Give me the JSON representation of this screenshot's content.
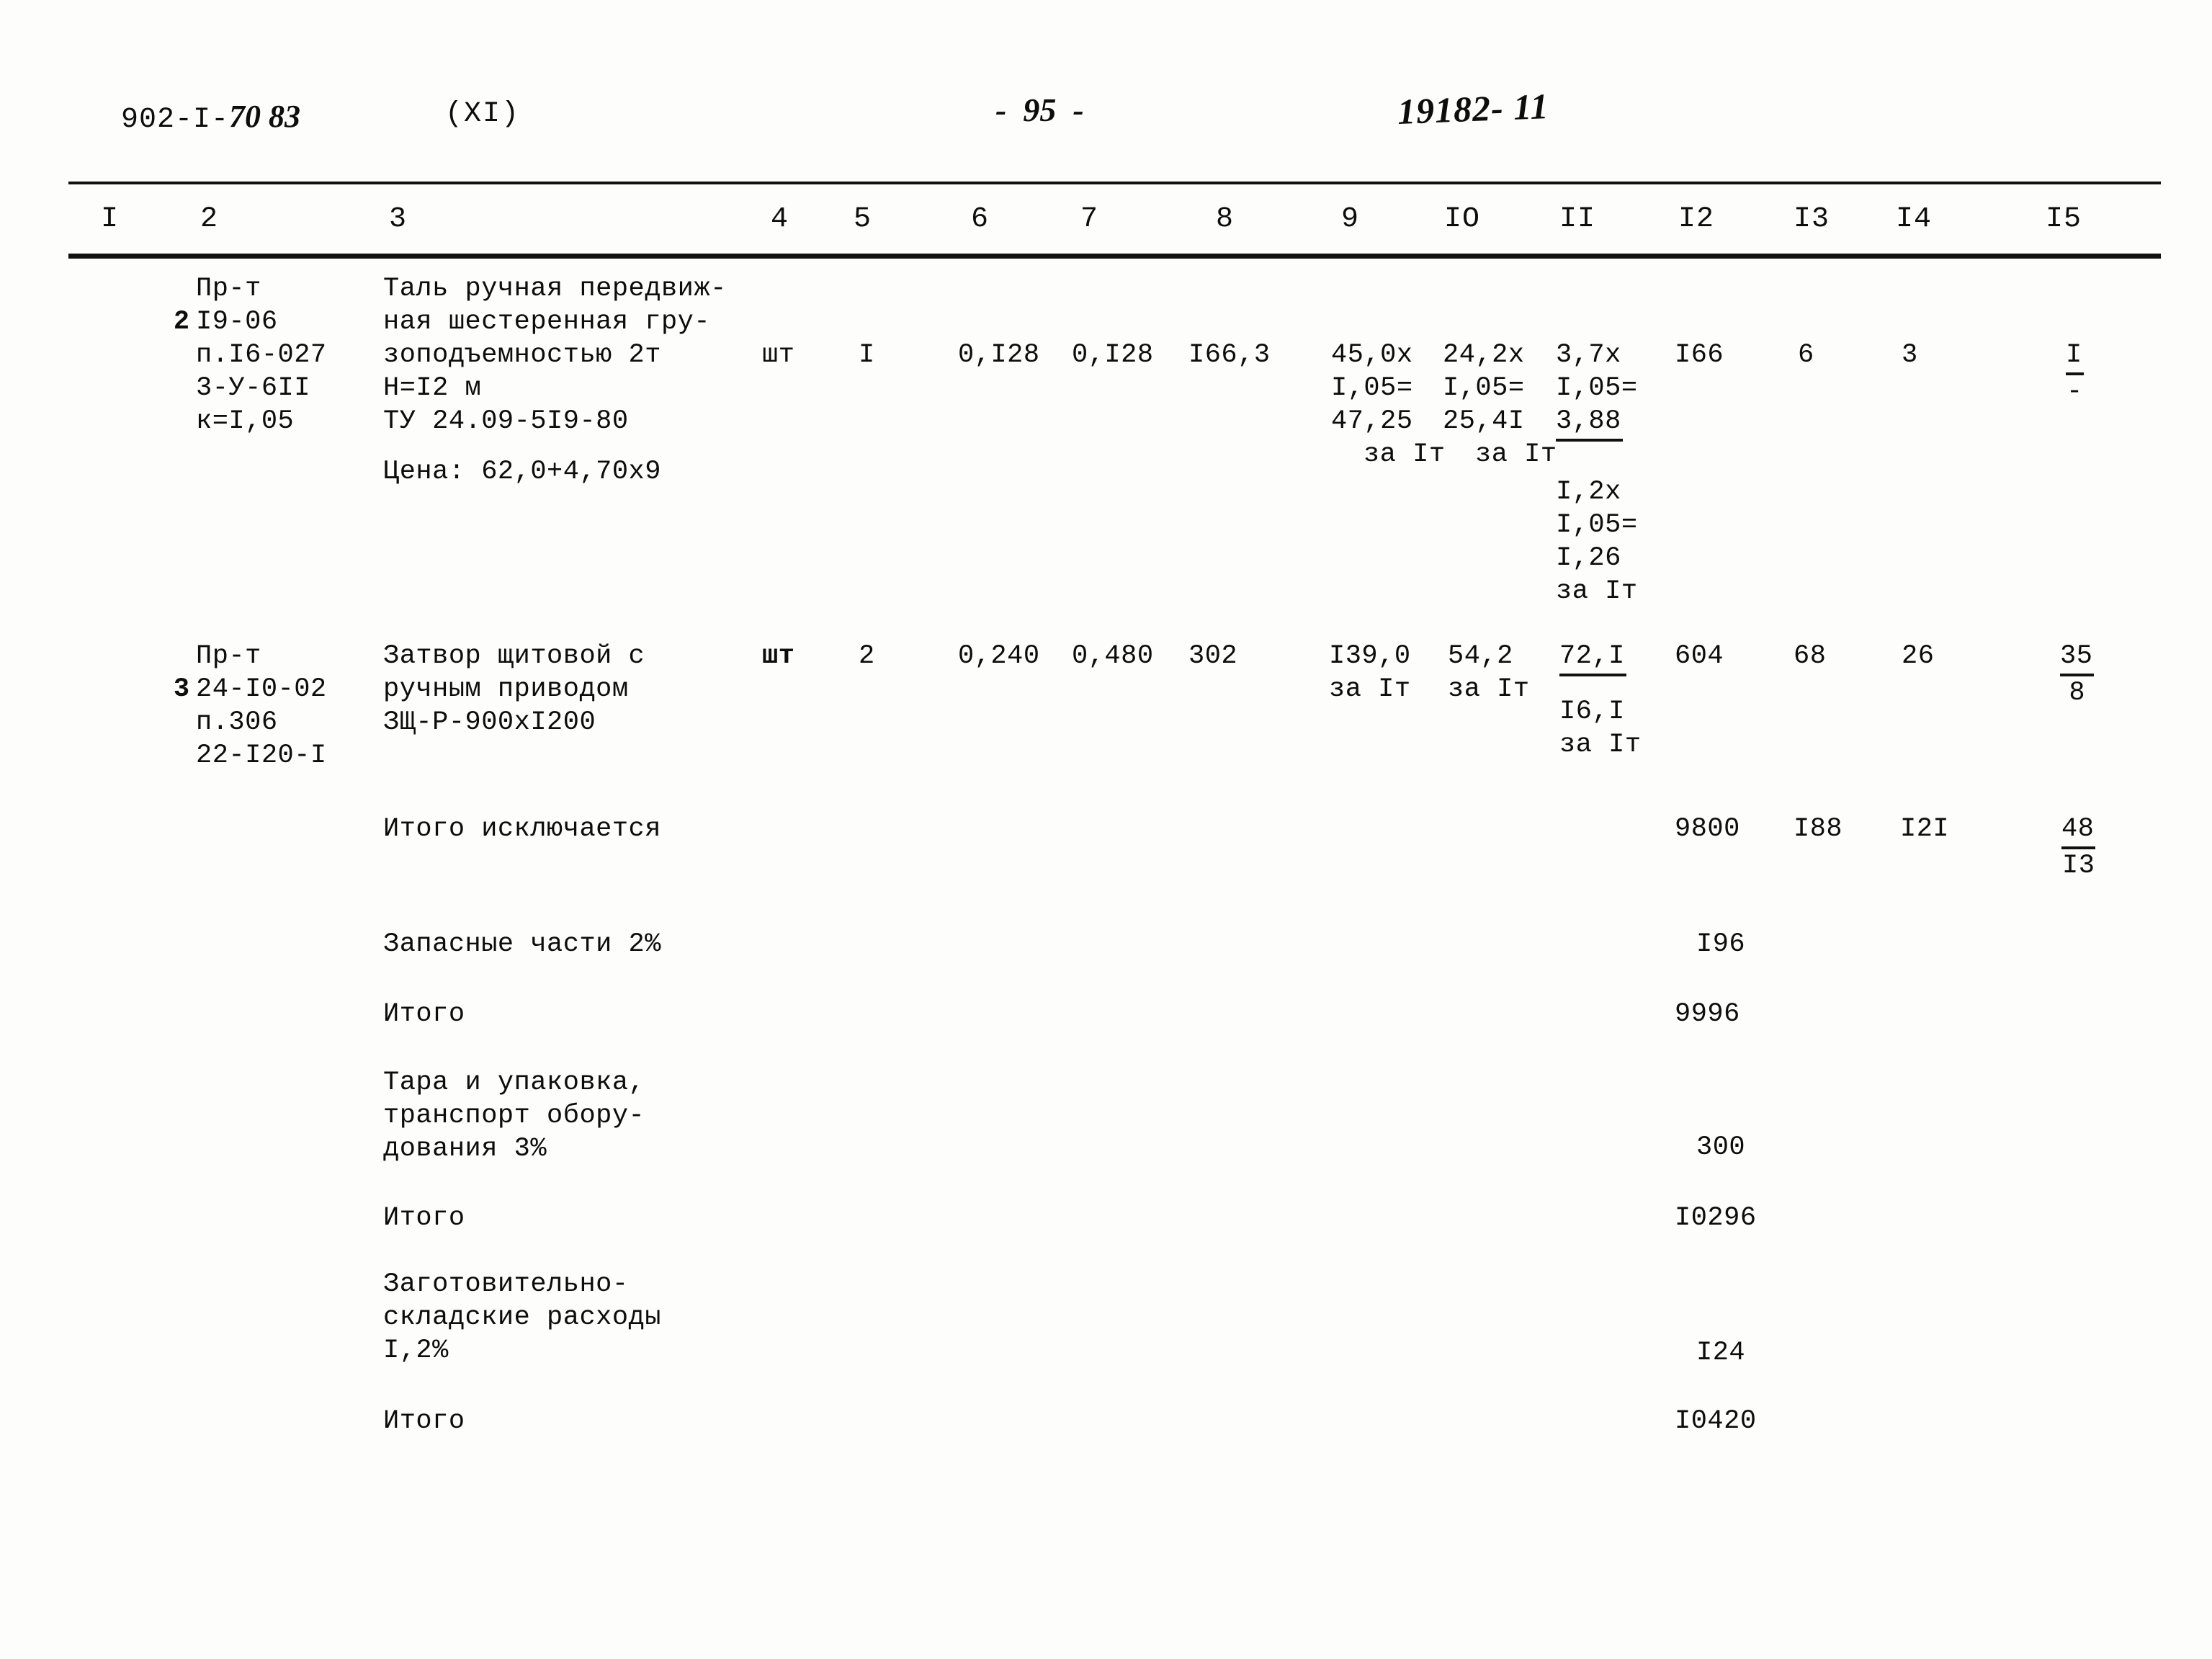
{
  "header": {
    "doc_code_prefix": "902-I-",
    "doc_code_hand": "70 83",
    "volume": "(XI)",
    "page_marker": "-  95  -",
    "stamp_number": "19182- 11"
  },
  "table": {
    "column_headers": [
      "I",
      "2",
      "3",
      "4",
      "5",
      "6",
      "7",
      "8",
      "9",
      "IO",
      "II",
      "I2",
      "I3",
      "I4",
      "I5"
    ],
    "rows": [
      {
        "num": "2",
        "code": "Пр-т\nI9-06\nп.I6-027\n3-У-6II\nк=I,05",
        "name": "Таль ручная передвиж-\nная шестеренная гру-\nзоподъемностью 2т\nH=I2 м\nТУ 24.09-5I9-80",
        "price_note": "Цена: 62,0+4,70x9",
        "unit": "шт",
        "qty": "I",
        "c6": "0,I28",
        "c7": "0,I28",
        "c8": "I66,3",
        "c9_top": "45,0x",
        "c9_mid": "I,05=",
        "c9_bot": "47,25",
        "c9_per": "за Iт",
        "c10_top": "24,2x",
        "c10_mid": "I,05=",
        "c10_bot": "25,4I",
        "c10_per": "за Iт",
        "c11_top": "3,7x",
        "c11_mid": "I,05=",
        "c11_bot": "3,88",
        "c11_top2": "I,2x",
        "c11_mid2": "I,05=",
        "c11_bot2": "I,26",
        "c11_per": "за Iт",
        "c12": "I66",
        "c13": "6",
        "c14": "3",
        "c15_top": "I",
        "c15_bot": "-"
      },
      {
        "num": "3",
        "code": "Пр-т\n24-I0-02\nп.306\n22-I20-I",
        "name": "Затвор щитовой с\nручным приводом\nЗЩ-Р-900хI200",
        "price_note": "",
        "unit": "шт",
        "qty": "2",
        "c6": "0,240",
        "c7": "0,480",
        "c8": "302",
        "c9_top": "I39,0",
        "c9_per": "за Iт",
        "c10_top": "54,2",
        "c10_per": "за Iт",
        "c11_top": "72,I",
        "c11_bot": "I6,I",
        "c11_per": "за Iт",
        "c12": "604",
        "c13": "68",
        "c14": "26",
        "c15_top": "35",
        "c15_bot": "8"
      }
    ],
    "summary": [
      {
        "label": "Итого исключается",
        "c12": "9800",
        "c13": "I88",
        "c14": "I2I",
        "c15_top": "48",
        "c15_bot": "I3"
      },
      {
        "label": "Запасные части 2%",
        "c12": "I96",
        "c13": "",
        "c14": "",
        "c15_top": "",
        "c15_bot": ""
      },
      {
        "label": "Итого",
        "c12": "9996",
        "c13": "",
        "c14": "",
        "c15_top": "",
        "c15_bot": ""
      },
      {
        "label": "Тара и упаковка,\nтранспорт обору-\nдования 3%",
        "c12": "300",
        "c13": "",
        "c14": "",
        "c15_top": "",
        "c15_bot": ""
      },
      {
        "label": "Итого",
        "c12": "I0296",
        "c13": "",
        "c14": "",
        "c15_top": "",
        "c15_bot": ""
      },
      {
        "label": "Заготовительно-\nскладские расходы\nI,2%",
        "c12": "I24",
        "c13": "",
        "c14": "",
        "c15_top": "",
        "c15_bot": ""
      },
      {
        "label": "Итого",
        "c12": "I0420",
        "c13": "",
        "c14": "",
        "c15_top": "",
        "c15_bot": ""
      }
    ]
  }
}
